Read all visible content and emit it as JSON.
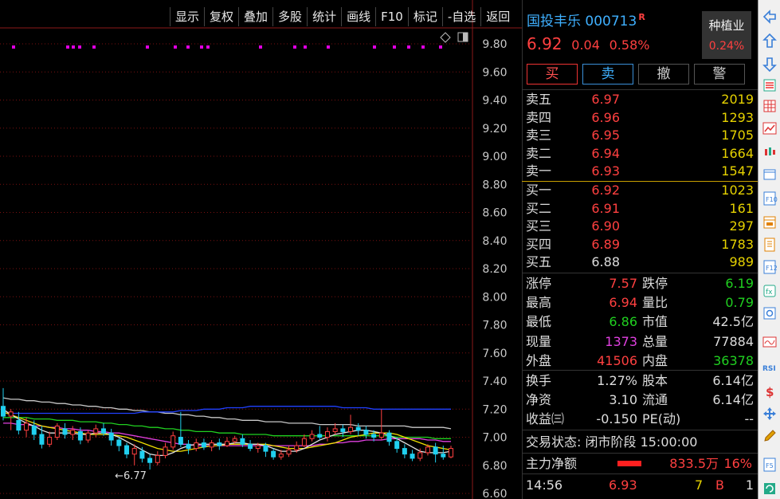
{
  "toolbar": [
    "显示",
    "复权",
    "叠加",
    "多股",
    "统计",
    "画线",
    "F10",
    "标记",
    "-自选",
    "返回"
  ],
  "y_axis": [
    "9.80",
    "9.60",
    "9.40",
    "9.20",
    "9.00",
    "8.80",
    "8.60",
    "8.40",
    "8.20",
    "8.00",
    "7.80",
    "7.60",
    "7.40",
    "7.20",
    "7.00",
    "6.80",
    "6.60"
  ],
  "low_marker": "←6.77",
  "stock": {
    "name": "国投丰乐",
    "code": "000713",
    "flag": "R",
    "price": "6.92",
    "change": "0.04",
    "pct": "0.58%"
  },
  "sector": {
    "name": "种植业",
    "pct": "0.24%"
  },
  "buttons": {
    "buy": "买",
    "sell": "卖",
    "cancel": "撤",
    "alert": "警"
  },
  "asks": [
    {
      "label": "卖五",
      "price": "6.97",
      "vol": "2019"
    },
    {
      "label": "卖四",
      "price": "6.96",
      "vol": "1293"
    },
    {
      "label": "卖三",
      "price": "6.95",
      "vol": "1705"
    },
    {
      "label": "卖二",
      "price": "6.94",
      "vol": "1664"
    },
    {
      "label": "卖一",
      "price": "6.93",
      "vol": "1547"
    }
  ],
  "bids": [
    {
      "label": "买一",
      "price": "6.92",
      "vol": "1023"
    },
    {
      "label": "买二",
      "price": "6.91",
      "vol": "161"
    },
    {
      "label": "买三",
      "price": "6.90",
      "vol": "297"
    },
    {
      "label": "买四",
      "price": "6.89",
      "vol": "1783"
    },
    {
      "label": "买五",
      "price": "6.88",
      "vol": "989"
    }
  ],
  "stats1": [
    {
      "l": "涨停",
      "v": "7.57",
      "l2": "跌停",
      "v2": "6.19"
    },
    {
      "l": "最高",
      "v": "6.94",
      "l2": "量比",
      "v2": "0.79"
    },
    {
      "l": "最低",
      "v": "6.86",
      "l2": "市值",
      "v2": "42.5亿"
    },
    {
      "l": "现量",
      "v": "1373",
      "l2": "总量",
      "v2": "77884"
    },
    {
      "l": "外盘",
      "v": "41506",
      "l2": "内盘",
      "v2": "36378"
    }
  ],
  "stats2": [
    {
      "l": "换手",
      "v": "1.27%",
      "l2": "股本",
      "v2": "6.14亿"
    },
    {
      "l": "净资",
      "v": "3.10",
      "l2": "流通",
      "v2": "6.14亿"
    },
    {
      "l": "收益㈢",
      "v": "-0.150",
      "l2": "PE(动)",
      "v2": "--"
    }
  ],
  "trade_status": "交易状态: 闭市阶段 15:00:00",
  "main_flow": {
    "label": "主力净额",
    "value": "833.5万",
    "pct": "16%"
  },
  "tick": {
    "time": "14:56",
    "price": "6.93",
    "vol": "7",
    "dir": "B",
    "n": "1"
  },
  "colors": {
    "up": "#ff4040",
    "down": "#20d0f0",
    "ma5": "#e0e0e0",
    "ma10": "#f0e000",
    "ma20": "#e040e0",
    "ma30": "#20d020",
    "ma60": "#2040ff",
    "mag": "#e000e0"
  },
  "chart_data": {
    "type": "candlestick",
    "ylim": [
      6.6,
      9.9
    ],
    "candles": [
      [
        7.22,
        7.15,
        7.35,
        7.12
      ],
      [
        7.15,
        7.18,
        7.2,
        7.05
      ],
      [
        7.12,
        7.05,
        7.18,
        7.02
      ],
      [
        7.05,
        7.1,
        7.14,
        7.0
      ],
      [
        7.08,
        7.02,
        7.12,
        6.98
      ],
      [
        7.02,
        6.95,
        7.08,
        6.92
      ],
      [
        6.95,
        7.0,
        7.04,
        6.93
      ],
      [
        7.0,
        7.08,
        7.1,
        6.98
      ],
      [
        7.06,
        7.02,
        7.1,
        6.99
      ],
      [
        7.02,
        7.05,
        7.08,
        6.98
      ],
      [
        7.04,
        6.98,
        7.07,
        6.95
      ],
      [
        6.98,
        7.03,
        7.05,
        6.96
      ],
      [
        7.03,
        7.06,
        7.09,
        7.0
      ],
      [
        7.06,
        7.03,
        7.1,
        7.01
      ],
      [
        7.03,
        6.98,
        7.06,
        6.94
      ],
      [
        6.98,
        6.94,
        7.0,
        6.9
      ],
      [
        6.94,
        6.88,
        6.96,
        6.85
      ],
      [
        6.88,
        6.92,
        6.95,
        6.8
      ],
      [
        6.9,
        6.85,
        6.93,
        6.82
      ],
      [
        6.85,
        6.82,
        6.88,
        6.77
      ],
      [
        6.82,
        6.87,
        6.9,
        6.8
      ],
      [
        6.87,
        6.93,
        6.96,
        6.85
      ],
      [
        6.93,
        7.01,
        7.04,
        6.91
      ],
      [
        7.0,
        6.95,
        7.18,
        6.93
      ],
      [
        6.95,
        6.92,
        6.98,
        6.88
      ],
      [
        6.92,
        6.96,
        6.99,
        6.9
      ],
      [
        6.96,
        6.93,
        6.99,
        6.91
      ],
      [
        6.93,
        6.96,
        6.98,
        6.9
      ],
      [
        6.96,
        6.94,
        6.99,
        6.91
      ],
      [
        6.94,
        6.97,
        7.0,
        6.93
      ],
      [
        6.97,
        6.99,
        7.01,
        6.95
      ],
      [
        6.99,
        6.95,
        7.02,
        6.93
      ],
      [
        6.95,
        6.92,
        6.98,
        6.9
      ],
      [
        6.92,
        6.94,
        6.96,
        6.89
      ],
      [
        6.94,
        6.9,
        6.96,
        6.86
      ],
      [
        6.9,
        6.86,
        6.92,
        6.84
      ],
      [
        6.86,
        6.88,
        6.91,
        6.84
      ],
      [
        6.88,
        6.91,
        6.94,
        6.86
      ],
      [
        6.91,
        6.94,
        6.97,
        6.89
      ],
      [
        6.94,
        6.99,
        7.02,
        6.93
      ],
      [
        6.99,
        7.02,
        7.05,
        6.97
      ],
      [
        7.02,
        7.0,
        7.08,
        6.98
      ],
      [
        7.0,
        7.04,
        7.07,
        6.97
      ],
      [
        7.04,
        7.06,
        7.1,
        7.02
      ],
      [
        7.06,
        7.04,
        7.09,
        7.0
      ],
      [
        7.04,
        7.07,
        7.16,
        7.02
      ],
      [
        7.07,
        7.05,
        7.1,
        7.01
      ],
      [
        7.05,
        7.02,
        7.08,
        6.99
      ],
      [
        7.02,
        7.0,
        7.05,
        6.97
      ],
      [
        7.0,
        7.03,
        7.2,
        6.98
      ],
      [
        7.03,
        6.97,
        7.05,
        6.94
      ],
      [
        6.97,
        6.92,
        7.0,
        6.89
      ],
      [
        6.92,
        6.88,
        6.95,
        6.85
      ],
      [
        6.88,
        6.85,
        6.91,
        6.83
      ],
      [
        6.85,
        6.89,
        6.92,
        6.83
      ],
      [
        6.89,
        6.93,
        6.95,
        6.87
      ],
      [
        6.93,
        6.88,
        6.96,
        6.82
      ],
      [
        6.88,
        6.86,
        6.94,
        6.84
      ],
      [
        6.86,
        6.92,
        6.94,
        6.85
      ]
    ],
    "ma5": [
      7.2,
      7.16,
      7.13,
      7.1,
      7.08,
      7.05,
      7.03,
      7.03,
      7.03,
      7.03,
      7.02,
      7.02,
      7.03,
      7.03,
      7.02,
      7.0,
      6.97,
      6.94,
      6.91,
      6.88,
      6.87,
      6.87,
      6.89,
      6.92,
      6.94,
      6.95,
      6.95,
      6.95,
      6.95,
      6.95,
      6.96,
      6.96,
      6.95,
      6.95,
      6.94,
      6.92,
      6.9,
      6.9,
      6.9,
      6.92,
      6.95,
      6.98,
      7.0,
      7.02,
      7.03,
      7.04,
      7.05,
      7.05,
      7.04,
      7.03,
      7.01,
      6.99,
      6.96,
      6.93,
      6.9,
      6.89,
      6.89,
      6.89,
      6.9
    ],
    "ma10": [
      7.18,
      7.16,
      7.14,
      7.12,
      7.1,
      7.08,
      7.07,
      7.06,
      7.05,
      7.04,
      7.03,
      7.02,
      7.02,
      7.02,
      7.02,
      7.01,
      7.0,
      6.98,
      6.96,
      6.94,
      6.92,
      6.91,
      6.9,
      6.9,
      6.91,
      6.92,
      6.93,
      6.94,
      6.94,
      6.95,
      6.95,
      6.95,
      6.95,
      6.95,
      6.95,
      6.94,
      6.93,
      6.92,
      6.92,
      6.92,
      6.93,
      6.94,
      6.95,
      6.96,
      6.98,
      7.0,
      7.01,
      7.02,
      7.03,
      7.03,
      7.03,
      7.02,
      7.0,
      6.98,
      6.96,
      6.94,
      6.93,
      6.92,
      6.91
    ],
    "ma20": [
      7.1,
      7.1,
      7.09,
      7.09,
      7.08,
      7.08,
      7.07,
      7.07,
      7.06,
      7.06,
      7.05,
      7.05,
      7.04,
      7.04,
      7.03,
      7.03,
      7.02,
      7.01,
      7.0,
      6.99,
      6.98,
      6.97,
      6.96,
      6.95,
      6.95,
      6.94,
      6.94,
      6.94,
      6.94,
      6.94,
      6.94,
      6.94,
      6.94,
      6.94,
      6.94,
      6.94,
      6.94,
      6.94,
      6.94,
      6.94,
      6.94,
      6.95,
      6.95,
      6.96,
      6.96,
      6.97,
      6.97,
      6.98,
      6.98,
      6.98,
      6.99,
      6.99,
      6.99,
      6.99,
      6.99,
      6.98,
      6.98,
      6.97,
      6.97
    ],
    "ma30": [
      7.14,
      7.14,
      7.14,
      7.14,
      7.13,
      7.13,
      7.13,
      7.12,
      7.12,
      7.12,
      7.11,
      7.11,
      7.11,
      7.1,
      7.1,
      7.09,
      7.09,
      7.08,
      7.08,
      7.07,
      7.07,
      7.06,
      7.06,
      7.05,
      7.05,
      7.04,
      7.04,
      7.04,
      7.03,
      7.03,
      7.03,
      7.02,
      7.02,
      7.02,
      7.02,
      7.01,
      7.01,
      7.01,
      7.01,
      7.01,
      7.01,
      7.01,
      7.01,
      7.01,
      7.01,
      7.01,
      7.01,
      7.01,
      7.01,
      7.01,
      7.01,
      7.0,
      7.0,
      7.0,
      7.0,
      7.0,
      6.99,
      6.99,
      6.99
    ],
    "ma60": [
      7.17,
      7.17,
      7.17,
      7.17,
      7.17,
      7.17,
      7.17,
      7.17,
      7.17,
      7.17,
      7.17,
      7.17,
      7.17,
      7.17,
      7.17,
      7.17,
      7.17,
      7.17,
      7.18,
      7.18,
      7.18,
      7.18,
      7.18,
      7.19,
      7.19,
      7.19,
      7.2,
      7.2,
      7.2,
      7.21,
      7.21,
      7.21,
      7.22,
      7.22,
      7.22,
      7.22,
      7.22,
      7.22,
      7.22,
      7.22,
      7.22,
      7.22,
      7.22,
      7.22,
      7.21,
      7.21,
      7.21,
      7.21,
      7.2,
      7.2,
      7.2,
      7.2,
      7.2,
      7.2,
      7.2,
      7.2,
      7.2,
      7.2,
      7.2
    ],
    "ma_long": [
      7.28,
      7.27,
      7.27,
      7.26,
      7.26,
      7.25,
      7.25,
      7.24,
      7.24,
      7.23,
      7.23,
      7.22,
      7.22,
      7.21,
      7.21,
      7.2,
      7.2,
      7.19,
      7.19,
      7.18,
      7.18,
      7.17,
      7.17,
      7.16,
      7.16,
      7.15,
      7.15,
      7.14,
      7.14,
      7.13,
      7.13,
      7.12,
      7.12,
      7.12,
      7.11,
      7.11,
      7.11,
      7.1,
      7.1,
      7.1,
      7.1,
      7.09,
      7.09,
      7.09,
      7.09,
      7.09,
      7.08,
      7.08,
      7.08,
      7.08,
      7.08,
      7.08,
      7.08,
      7.07,
      7.07,
      7.07,
      7.07,
      7.07,
      7.06
    ]
  }
}
